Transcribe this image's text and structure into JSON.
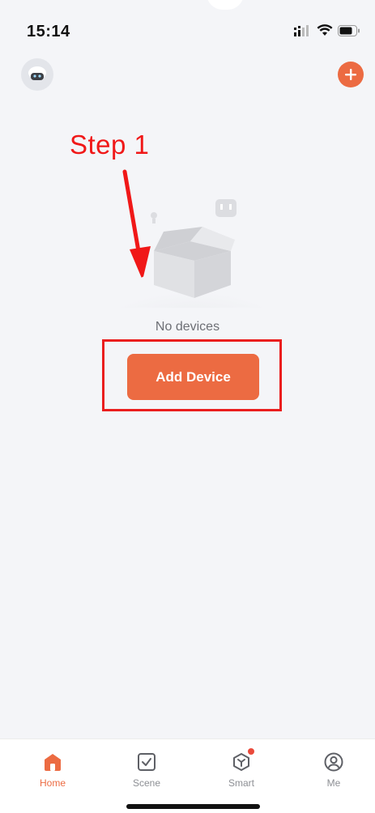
{
  "status_bar": {
    "time": "15:14",
    "icons": [
      "signal-icon",
      "wifi-icon",
      "battery-icon"
    ]
  },
  "header": {
    "avatar_icon": "robot-avatar-icon",
    "add_icon": "plus-circle-icon"
  },
  "annotation": {
    "step_label": "Step 1",
    "color": "#f01818"
  },
  "empty_state": {
    "message": "No devices",
    "illustration": "empty-box-icon"
  },
  "primary_action": {
    "label": "Add Device",
    "color": "#ec6b42"
  },
  "tab_bar": {
    "active_color": "#ec6b42",
    "tabs": [
      {
        "label": "Home",
        "icon": "home-icon",
        "active": true
      },
      {
        "label": "Scene",
        "icon": "checkbox-icon",
        "active": false
      },
      {
        "label": "Smart",
        "icon": "cube-icon",
        "active": false,
        "badge": true
      },
      {
        "label": "Me",
        "icon": "user-icon",
        "active": false
      }
    ]
  }
}
